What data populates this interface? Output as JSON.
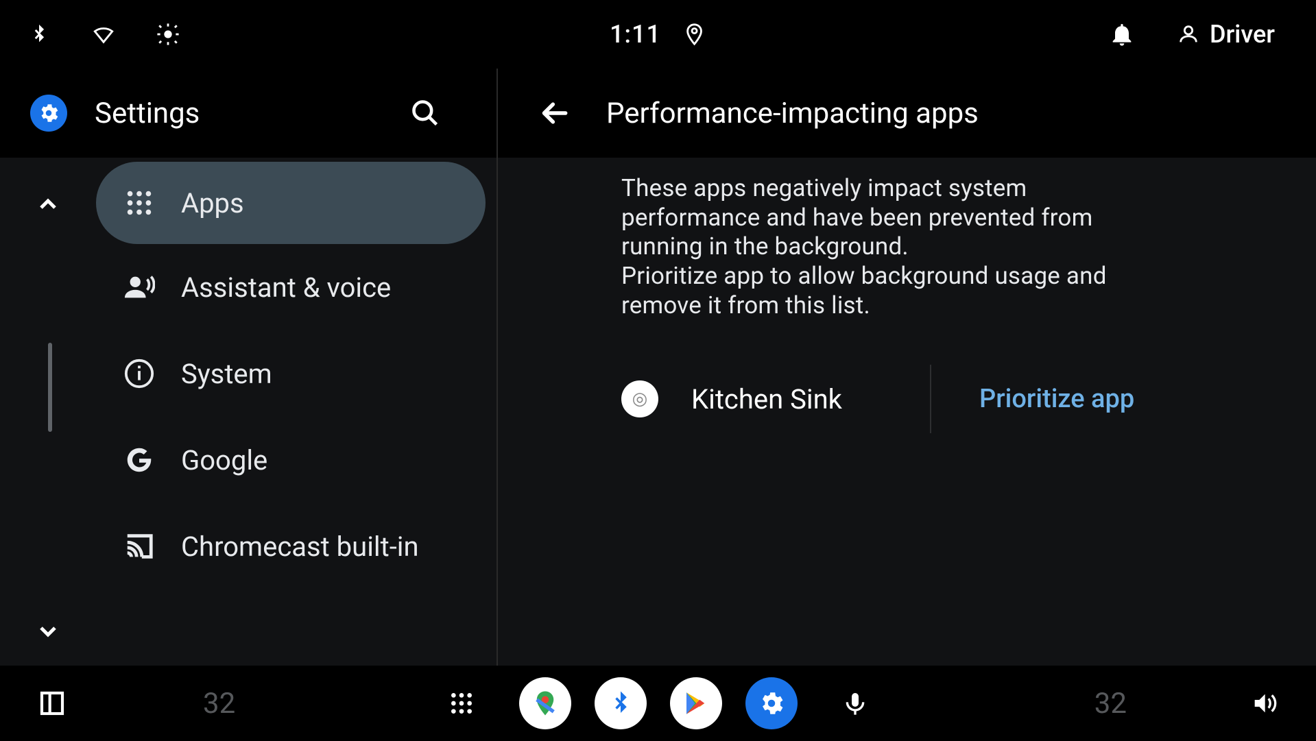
{
  "statusbar": {
    "time": "1:11",
    "profile_name": "Driver"
  },
  "left": {
    "title": "Settings",
    "items": [
      {
        "label": "Apps"
      },
      {
        "label": "Assistant & voice"
      },
      {
        "label": "System"
      },
      {
        "label": "Google"
      },
      {
        "label": "Chromecast built-in"
      }
    ]
  },
  "right": {
    "title": "Performance-impacting apps",
    "description": "These apps negatively impact system performance and have been prevented from running in the background.\nPrioritize app to allow background usage and remove it from this list.",
    "app": {
      "name": "Kitchen Sink",
      "action": "Prioritize app"
    }
  },
  "bottombar": {
    "temp_left": "32",
    "temp_right": "32"
  },
  "colors": {
    "accent": "#1a73e8",
    "link": "#6fb1e6",
    "panel": "#111214",
    "side_active": "#3c4b55"
  }
}
